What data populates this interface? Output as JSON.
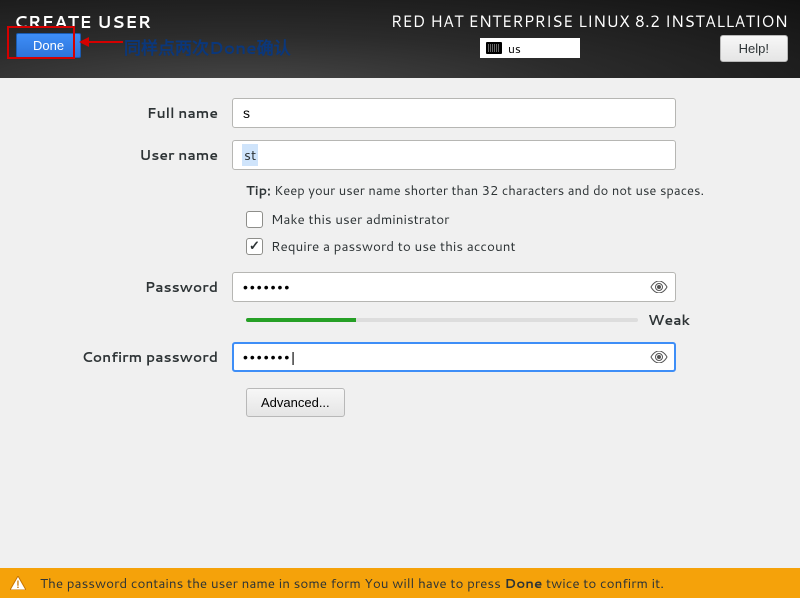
{
  "header": {
    "title": "CREATE USER",
    "installer_title": "RED HAT ENTERPRISE LINUX 8.2 INSTALLATION",
    "done_label": "Done",
    "keyboard_layout": "us",
    "help_label": "Help!"
  },
  "annotation": {
    "text": "同样点两次Done确认"
  },
  "form": {
    "full_name_label": "Full name",
    "full_name_value": "s",
    "user_name_label": "User name",
    "user_name_value": "st",
    "tip_label": "Tip:",
    "tip_text": " Keep your user name shorter than 32 characters and do not use spaces.",
    "make_admin_label": "Make this user administrator",
    "make_admin_checked": false,
    "require_pw_label": "Require a password to use this account",
    "require_pw_checked": true,
    "password_label": "Password",
    "password_value": "•••••••",
    "strength_label": "Weak",
    "confirm_label": "Confirm password",
    "confirm_value": "•••••••",
    "advanced_label": "Advanced..."
  },
  "warning": {
    "text_pre": "The password contains the user name in some form You will have to press ",
    "bold": "Done",
    "text_post": " twice to confirm it."
  }
}
